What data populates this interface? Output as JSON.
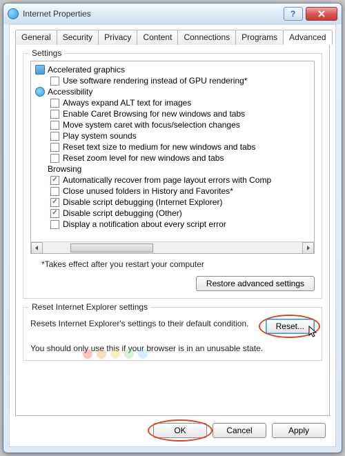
{
  "window": {
    "title": "Internet Properties"
  },
  "tabs": [
    "General",
    "Security",
    "Privacy",
    "Content",
    "Connections",
    "Programs",
    "Advanced"
  ],
  "activeTab": "Advanced",
  "settings": {
    "legend": "Settings",
    "groups": [
      {
        "icon": "display",
        "label": "Accelerated graphics",
        "items": [
          {
            "checked": false,
            "label": "Use software rendering instead of GPU rendering*"
          }
        ]
      },
      {
        "icon": "access",
        "label": "Accessibility",
        "items": [
          {
            "checked": false,
            "label": "Always expand ALT text for images"
          },
          {
            "checked": false,
            "label": "Enable Caret Browsing for new windows and tabs"
          },
          {
            "checked": false,
            "label": "Move system caret with focus/selection changes"
          },
          {
            "checked": false,
            "label": "Play system sounds"
          },
          {
            "checked": false,
            "label": "Reset text size to medium for new windows and tabs"
          },
          {
            "checked": false,
            "label": "Reset zoom level for new windows and tabs"
          }
        ]
      },
      {
        "icon": "",
        "label": "Browsing",
        "items": [
          {
            "checked": true,
            "label": "Automatically recover from page layout errors with Comp"
          },
          {
            "checked": false,
            "label": "Close unused folders in History and Favorites*"
          },
          {
            "checked": true,
            "label": "Disable script debugging (Internet Explorer)"
          },
          {
            "checked": true,
            "label": "Disable script debugging (Other)"
          },
          {
            "checked": false,
            "label": "Display a notification about every script error"
          }
        ]
      }
    ],
    "note": "*Takes effect after you restart your computer",
    "restore": "Restore advanced settings"
  },
  "reset": {
    "legend": "Reset Internet Explorer settings",
    "desc": "Resets Internet Explorer's settings to their default condition.",
    "button": "Reset...",
    "warn": "You should only use this if your browser is in an unusable state."
  },
  "buttons": {
    "ok": "OK",
    "cancel": "Cancel",
    "apply": "Apply"
  }
}
